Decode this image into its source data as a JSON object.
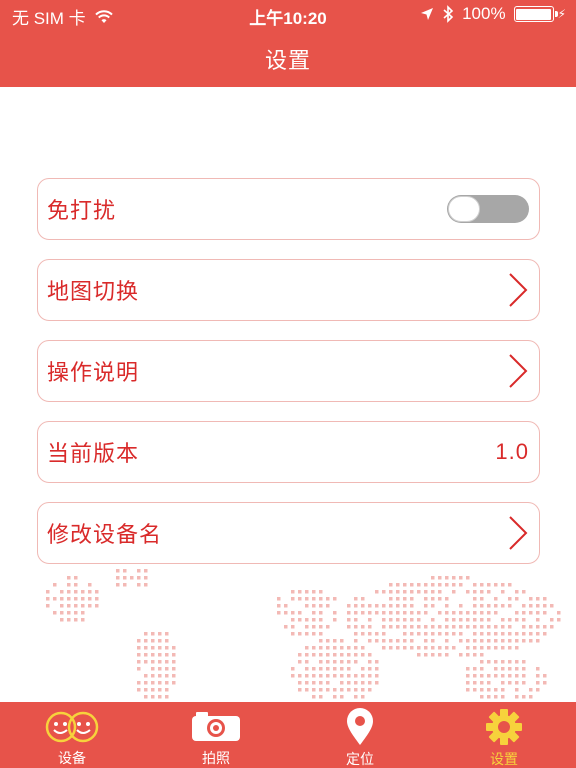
{
  "status_bar": {
    "carrier": "无 SIM 卡",
    "time": "上午10:20",
    "battery": "100%"
  },
  "nav": {
    "title": "设置"
  },
  "settings": {
    "do_not_disturb": {
      "label": "免打扰",
      "enabled": false
    },
    "map_switch": {
      "label": "地图切换"
    },
    "instructions": {
      "label": "操作说明"
    },
    "version": {
      "label": "当前版本",
      "value": "1.0"
    },
    "rename_device": {
      "label": "修改设备名"
    }
  },
  "tabs": [
    {
      "label": "设备",
      "icon": "couple-faces-icon"
    },
    {
      "label": "拍照",
      "icon": "camera-icon"
    },
    {
      "label": "定位",
      "icon": "location-pin-icon"
    },
    {
      "label": "设置",
      "icon": "gear-icon",
      "active": true
    }
  ],
  "colors": {
    "accent": "#e7534a",
    "text_red": "#d92a2a",
    "active_tab": "#f7d23c",
    "row_border": "#f0b9b5"
  }
}
